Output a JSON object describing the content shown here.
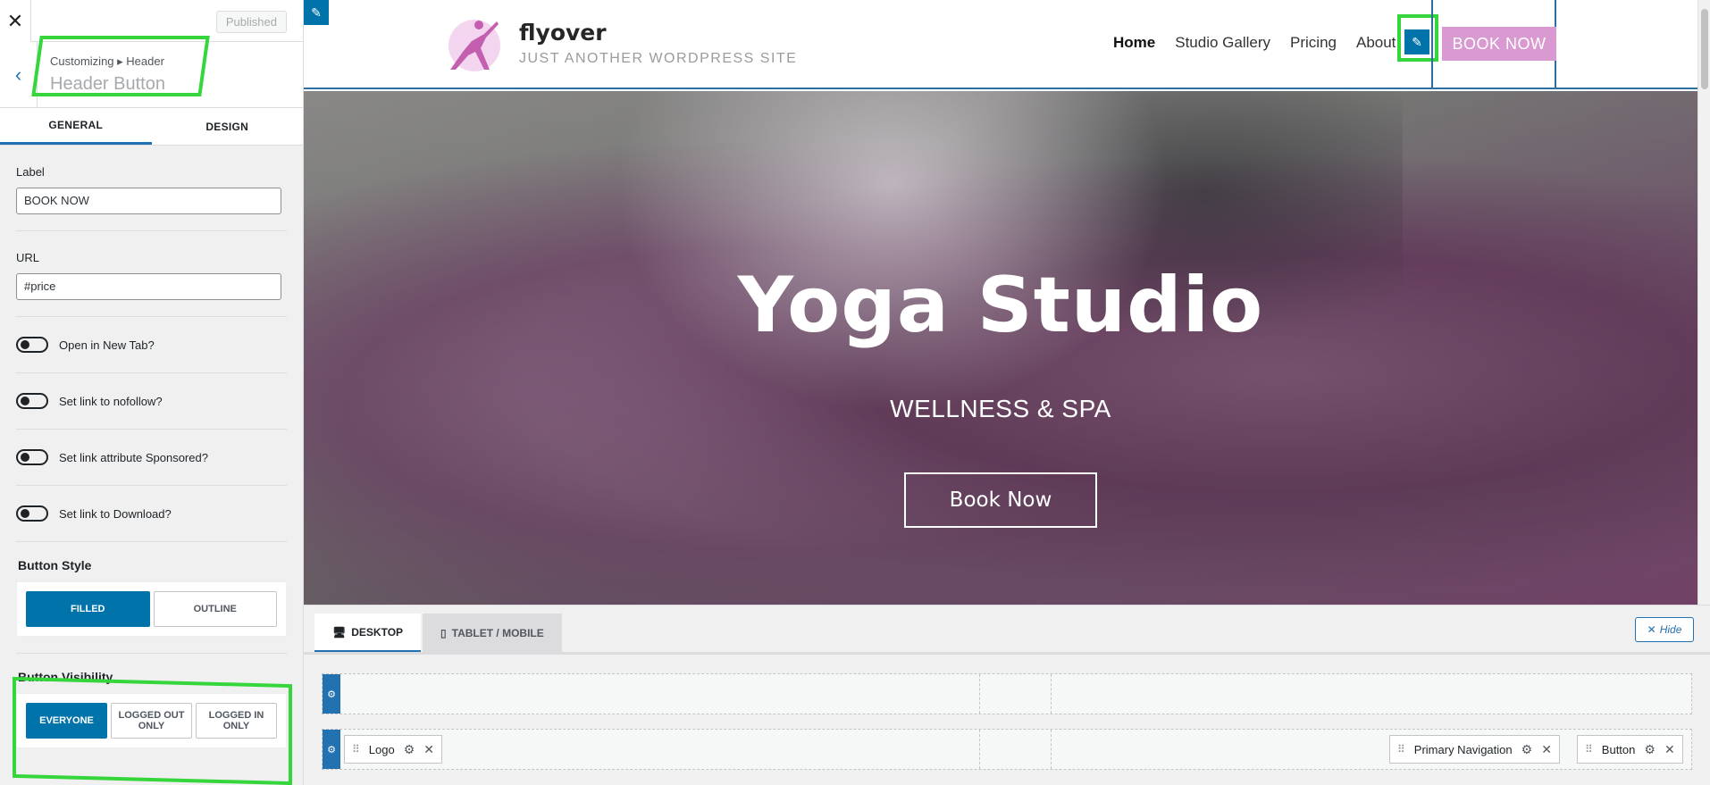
{
  "sidebar": {
    "close_label": "✕",
    "published_label": "Published",
    "breadcrumb": "Customizing ▸ Header",
    "title": "Header Button",
    "tabs": [
      {
        "label": "GENERAL"
      },
      {
        "label": "DESIGN"
      }
    ],
    "label_field": {
      "label": "Label",
      "value": "BOOK NOW"
    },
    "url_field": {
      "label": "URL",
      "value": "#price"
    },
    "toggles": [
      {
        "label": "Open in New Tab?"
      },
      {
        "label": "Set link to nofollow?"
      },
      {
        "label": "Set link attribute Sponsored?"
      },
      {
        "label": "Set link to Download?"
      }
    ],
    "button_style": {
      "title": "Button Style",
      "options": [
        "FILLED",
        "OUTLINE"
      ],
      "selected": "FILLED"
    },
    "button_visibility": {
      "title": "Button Visibility",
      "options": [
        "EVERYONE",
        "LOGGED OUT ONLY",
        "LOGGED IN ONLY"
      ],
      "selected": "EVERYONE"
    }
  },
  "preview": {
    "site_title": "flyover",
    "tagline": "JUST ANOTHER WORDPRESS SITE",
    "nav": [
      "Home",
      "Studio Gallery",
      "Pricing",
      "About"
    ],
    "header_button": "BOOK NOW",
    "hero_title": "Yoga Studio",
    "hero_subtitle": "WELLNESS & SPA",
    "hero_button": "Book Now",
    "accent_color": "#d99ad2"
  },
  "builder": {
    "tabs": [
      "DESKTOP",
      "TABLET / MOBILE"
    ],
    "hide_label": "Hide",
    "items": {
      "logo": "Logo",
      "primary_nav": "Primary Navigation",
      "button": "Button"
    }
  },
  "colors": {
    "primary": "#0073aa",
    "highlight": "#35d63b"
  }
}
